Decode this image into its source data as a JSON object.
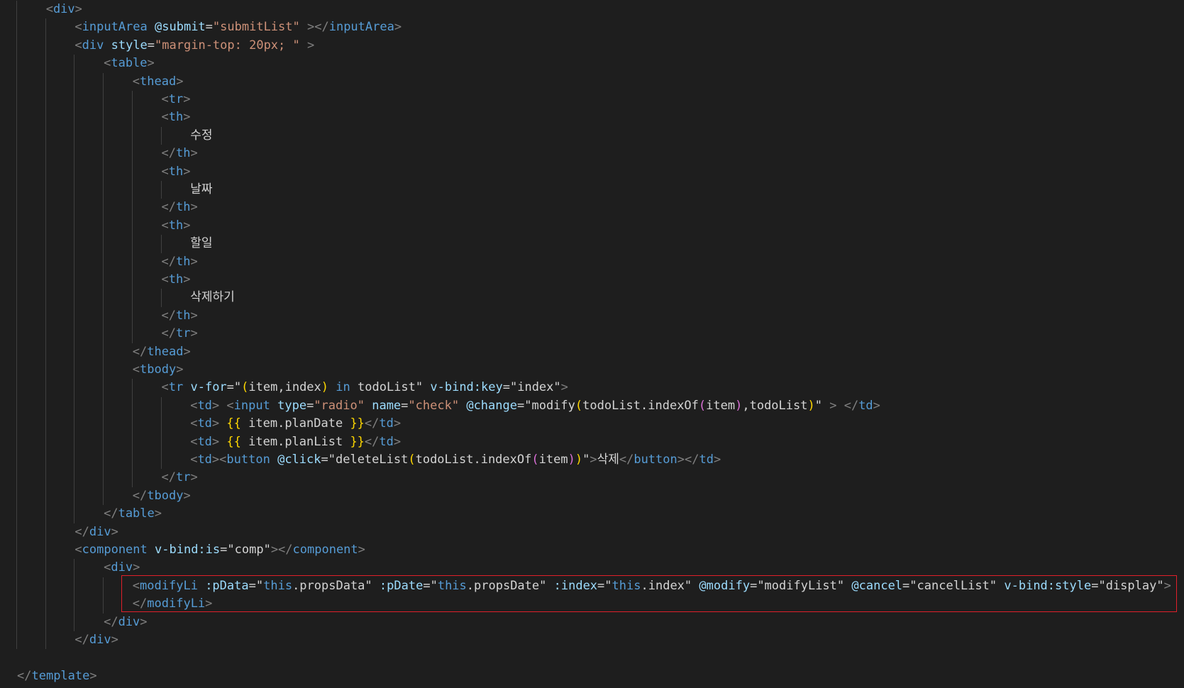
{
  "editor": {
    "language": "vue",
    "lines": [
      {
        "indent": 1,
        "tokens": [
          [
            "t",
            "<"
          ],
          [
            "n",
            "div"
          ],
          [
            "t",
            ">"
          ]
        ]
      },
      {
        "indent": 2,
        "tokens": [
          [
            "t",
            "<"
          ],
          [
            "n",
            "inputArea"
          ],
          [
            "p",
            " "
          ],
          [
            "a",
            "@submit"
          ],
          [
            "p",
            "="
          ],
          [
            "s",
            "\"submitList\""
          ],
          [
            "p",
            " "
          ],
          [
            "t",
            "></"
          ],
          [
            "n",
            "inputArea"
          ],
          [
            "t",
            ">"
          ]
        ]
      },
      {
        "indent": 2,
        "tokens": [
          [
            "t",
            "<"
          ],
          [
            "n",
            "div"
          ],
          [
            "p",
            " "
          ],
          [
            "a",
            "style"
          ],
          [
            "p",
            "="
          ],
          [
            "s",
            "\"margin-top: 20px; \""
          ],
          [
            "p",
            " "
          ],
          [
            "t",
            ">"
          ]
        ]
      },
      {
        "indent": 3,
        "tokens": [
          [
            "t",
            "<"
          ],
          [
            "n",
            "table"
          ],
          [
            "t",
            ">"
          ]
        ]
      },
      {
        "indent": 4,
        "tokens": [
          [
            "t",
            "<"
          ],
          [
            "n",
            "thead"
          ],
          [
            "t",
            ">"
          ]
        ]
      },
      {
        "indent": 5,
        "tokens": [
          [
            "t",
            "<"
          ],
          [
            "n",
            "tr"
          ],
          [
            "t",
            ">"
          ]
        ]
      },
      {
        "indent": 5,
        "tokens": [
          [
            "t",
            "<"
          ],
          [
            "n",
            "th"
          ],
          [
            "t",
            ">"
          ]
        ]
      },
      {
        "indent": 6,
        "tokens": [
          [
            "kr",
            "수정"
          ]
        ]
      },
      {
        "indent": 5,
        "tokens": [
          [
            "t",
            "</"
          ],
          [
            "n",
            "th"
          ],
          [
            "t",
            ">"
          ]
        ]
      },
      {
        "indent": 5,
        "tokens": [
          [
            "t",
            "<"
          ],
          [
            "n",
            "th"
          ],
          [
            "t",
            ">"
          ]
        ]
      },
      {
        "indent": 6,
        "tokens": [
          [
            "kr",
            "날짜"
          ]
        ]
      },
      {
        "indent": 5,
        "tokens": [
          [
            "t",
            "</"
          ],
          [
            "n",
            "th"
          ],
          [
            "t",
            ">"
          ]
        ]
      },
      {
        "indent": 5,
        "tokens": [
          [
            "t",
            "<"
          ],
          [
            "n",
            "th"
          ],
          [
            "t",
            ">"
          ]
        ]
      },
      {
        "indent": 6,
        "tokens": [
          [
            "kr",
            "할일"
          ]
        ]
      },
      {
        "indent": 5,
        "tokens": [
          [
            "t",
            "</"
          ],
          [
            "n",
            "th"
          ],
          [
            "t",
            ">"
          ]
        ]
      },
      {
        "indent": 5,
        "tokens": [
          [
            "t",
            "<"
          ],
          [
            "n",
            "th"
          ],
          [
            "t",
            ">"
          ]
        ]
      },
      {
        "indent": 6,
        "tokens": [
          [
            "kr",
            "삭제하기"
          ]
        ]
      },
      {
        "indent": 5,
        "tokens": [
          [
            "t",
            "</"
          ],
          [
            "n",
            "th"
          ],
          [
            "t",
            ">"
          ]
        ]
      },
      {
        "indent": 5,
        "tokens": [
          [
            "t",
            "</"
          ],
          [
            "n",
            "tr"
          ],
          [
            "t",
            ">"
          ]
        ]
      },
      {
        "indent": 4,
        "tokens": [
          [
            "t",
            "</"
          ],
          [
            "n",
            "thead"
          ],
          [
            "t",
            ">"
          ]
        ]
      },
      {
        "indent": 4,
        "tokens": [
          [
            "t",
            "<"
          ],
          [
            "n",
            "tbody"
          ],
          [
            "t",
            ">"
          ]
        ]
      },
      {
        "indent": 5,
        "tokens": [
          [
            "t",
            "<"
          ],
          [
            "n",
            "tr"
          ],
          [
            "p",
            " "
          ],
          [
            "a",
            "v-for"
          ],
          [
            "p",
            "="
          ],
          [
            "w",
            "\""
          ],
          [
            "y",
            "("
          ],
          [
            "w",
            "item,index"
          ],
          [
            "y",
            ")"
          ],
          [
            "p",
            " "
          ],
          [
            "k",
            "in"
          ],
          [
            "w",
            " todoList\""
          ],
          [
            "p",
            " "
          ],
          [
            "a",
            "v-bind:key"
          ],
          [
            "p",
            "="
          ],
          [
            "w",
            "\"index\""
          ],
          [
            "t",
            ">"
          ]
        ]
      },
      {
        "indent": 6,
        "tokens": [
          [
            "t",
            "<"
          ],
          [
            "n",
            "td"
          ],
          [
            "t",
            ">"
          ],
          [
            "p",
            " "
          ],
          [
            "t",
            "<"
          ],
          [
            "n",
            "input"
          ],
          [
            "p",
            " "
          ],
          [
            "a",
            "type"
          ],
          [
            "p",
            "="
          ],
          [
            "s",
            "\"radio\""
          ],
          [
            "p",
            " "
          ],
          [
            "a",
            "name"
          ],
          [
            "p",
            "="
          ],
          [
            "s",
            "\"check\""
          ],
          [
            "p",
            " "
          ],
          [
            "a",
            "@change"
          ],
          [
            "p",
            "="
          ],
          [
            "w",
            "\"modify"
          ],
          [
            "y",
            "("
          ],
          [
            "w",
            "todoList.indexOf"
          ],
          [
            "v",
            "("
          ],
          [
            "w",
            "item"
          ],
          [
            "v",
            ")"
          ],
          [
            "w",
            ",todoList"
          ],
          [
            "y",
            ")"
          ],
          [
            "w",
            "\""
          ],
          [
            "p",
            " "
          ],
          [
            "t",
            "> </"
          ],
          [
            "n",
            "td"
          ],
          [
            "t",
            ">"
          ]
        ]
      },
      {
        "indent": 6,
        "tokens": [
          [
            "t",
            "<"
          ],
          [
            "n",
            "td"
          ],
          [
            "t",
            ">"
          ],
          [
            "p",
            " "
          ],
          [
            "y",
            "{{"
          ],
          [
            "p",
            " item.planDate "
          ],
          [
            "y",
            "}}"
          ],
          [
            "t",
            "</"
          ],
          [
            "n",
            "td"
          ],
          [
            "t",
            ">"
          ]
        ]
      },
      {
        "indent": 6,
        "tokens": [
          [
            "t",
            "<"
          ],
          [
            "n",
            "td"
          ],
          [
            "t",
            ">"
          ],
          [
            "p",
            " "
          ],
          [
            "y",
            "{{"
          ],
          [
            "p",
            " item.planList "
          ],
          [
            "y",
            "}}"
          ],
          [
            "t",
            "</"
          ],
          [
            "n",
            "td"
          ],
          [
            "t",
            ">"
          ]
        ]
      },
      {
        "indent": 6,
        "tokens": [
          [
            "t",
            "<"
          ],
          [
            "n",
            "td"
          ],
          [
            "t",
            "><"
          ],
          [
            "n",
            "button"
          ],
          [
            "p",
            " "
          ],
          [
            "a",
            "@click"
          ],
          [
            "p",
            "="
          ],
          [
            "w",
            "\"deleteList"
          ],
          [
            "y",
            "("
          ],
          [
            "w",
            "todoList.indexOf"
          ],
          [
            "v",
            "("
          ],
          [
            "w",
            "item"
          ],
          [
            "v",
            ")"
          ],
          [
            "y",
            ")"
          ],
          [
            "w",
            "\""
          ],
          [
            "t",
            ">"
          ],
          [
            "kr",
            "삭제"
          ],
          [
            "t",
            "</"
          ],
          [
            "n",
            "button"
          ],
          [
            "t",
            "></"
          ],
          [
            "n",
            "td"
          ],
          [
            "t",
            ">"
          ]
        ]
      },
      {
        "indent": 5,
        "tokens": [
          [
            "t",
            "</"
          ],
          [
            "n",
            "tr"
          ],
          [
            "t",
            ">"
          ]
        ]
      },
      {
        "indent": 4,
        "tokens": [
          [
            "t",
            "</"
          ],
          [
            "n",
            "tbody"
          ],
          [
            "t",
            ">"
          ]
        ]
      },
      {
        "indent": 3,
        "tokens": [
          [
            "t",
            "</"
          ],
          [
            "n",
            "table"
          ],
          [
            "t",
            ">"
          ]
        ]
      },
      {
        "indent": 2,
        "tokens": [
          [
            "t",
            "</"
          ],
          [
            "n",
            "div"
          ],
          [
            "t",
            ">"
          ]
        ]
      },
      {
        "indent": 2,
        "tokens": [
          [
            "t",
            "<"
          ],
          [
            "n",
            "component"
          ],
          [
            "p",
            " "
          ],
          [
            "a",
            "v-bind:is"
          ],
          [
            "p",
            "="
          ],
          [
            "w",
            "\"comp\""
          ],
          [
            "t",
            "></"
          ],
          [
            "n",
            "component"
          ],
          [
            "t",
            ">"
          ]
        ]
      },
      {
        "indent": 3,
        "tokens": [
          [
            "t",
            "<"
          ],
          [
            "n",
            "div"
          ],
          [
            "t",
            ">"
          ]
        ]
      },
      {
        "indent": 4,
        "tokens": [
          [
            "t",
            "<"
          ],
          [
            "n",
            "modifyLi"
          ],
          [
            "p",
            " "
          ],
          [
            "a",
            ":pData"
          ],
          [
            "p",
            "="
          ],
          [
            "w",
            "\""
          ],
          [
            "k",
            "this"
          ],
          [
            "w",
            ".propsData\""
          ],
          [
            "p",
            " "
          ],
          [
            "a",
            ":pDate"
          ],
          [
            "p",
            "="
          ],
          [
            "w",
            "\""
          ],
          [
            "k",
            "this"
          ],
          [
            "w",
            ".propsDate\""
          ],
          [
            "p",
            " "
          ],
          [
            "a",
            ":index"
          ],
          [
            "p",
            "="
          ],
          [
            "w",
            "\""
          ],
          [
            "k",
            "this"
          ],
          [
            "w",
            ".index\""
          ],
          [
            "p",
            " "
          ],
          [
            "a",
            "@modify"
          ],
          [
            "p",
            "="
          ],
          [
            "w",
            "\"modifyList\""
          ],
          [
            "p",
            " "
          ],
          [
            "a",
            "@cancel"
          ],
          [
            "p",
            "="
          ],
          [
            "w",
            "\"cancelList\""
          ],
          [
            "p",
            " "
          ],
          [
            "a",
            "v-bind:style"
          ],
          [
            "p",
            "="
          ],
          [
            "w",
            "\"display\""
          ],
          [
            "t",
            ">"
          ]
        ]
      },
      {
        "indent": 4,
        "tokens": [
          [
            "t",
            "</"
          ],
          [
            "n",
            "modifyLi"
          ],
          [
            "t",
            ">"
          ]
        ]
      },
      {
        "indent": 3,
        "tokens": [
          [
            "t",
            "</"
          ],
          [
            "n",
            "div"
          ],
          [
            "t",
            ">"
          ]
        ]
      },
      {
        "indent": 2,
        "tokens": [
          [
            "t",
            "</"
          ],
          [
            "n",
            "div"
          ],
          [
            "t",
            ">"
          ]
        ]
      },
      {
        "indent": 0,
        "tokens": []
      },
      {
        "indent": 0,
        "tokens": [
          [
            "t",
            "</"
          ],
          [
            "n",
            "template"
          ],
          [
            "t",
            ">"
          ]
        ]
      }
    ]
  }
}
